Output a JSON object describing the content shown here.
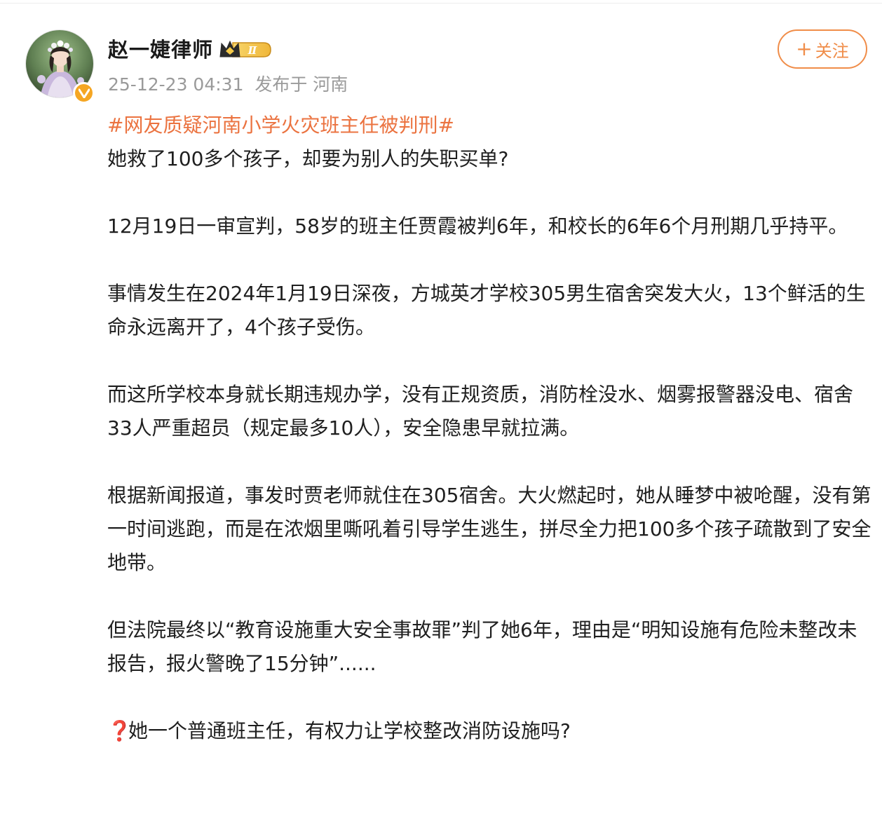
{
  "post": {
    "author": {
      "name": "赵一婕律师",
      "vip_level": "Ⅱ"
    },
    "meta": "25-12-23 04:31  发布于 河南",
    "follow_label": "关注",
    "follow_plus": "+",
    "hashtag": "#网友质疑河南小学火灾班主任被判刑#",
    "paragraphs": [
      "她救了100多个孩子，却要为别人的失职买单?",
      "12月19日一审宣判，58岁的班主任贾霞被判6年，和校长的6年6个月刑期几乎持平。",
      "事情发生在2024年1月19日深夜，方城英才学校305男生宿舍突发大火，13个鲜活的生命永远离开了，4个孩子受伤。",
      "而这所学校本身就长期违规办学，没有正规资质，消防栓没水、烟雾报警器没电、宿舍33人严重超员（规定最多10人），安全隐患早就拉满。",
      "根据新闻报道，事发时贾老师就住在305宿舍。大火燃起时，她从睡梦中被呛醒，没有第一时间逃跑，而是在浓烟里嘶吼着引导学生逃生，拼尽全力把100多个孩子疏散到了安全地带。",
      "但法院最终以“教育设施重大安全事故罪”判了她6年，理由是“明知设施有危险未整改未报告，报火警晚了15分钟”......"
    ],
    "question": {
      "icon": "❓",
      "text": "她一个普通班主任，有权力让学校整改消防设施吗?"
    }
  },
  "colors": {
    "hashtag": "#eb7340",
    "follow": "#f08d49",
    "verified": "#f5a623",
    "meta": "#9a9a9a"
  },
  "icons": {
    "avatar": "avatar-photo",
    "verified": "verified-v-icon",
    "vip": "crown-vip-icon",
    "question": "red-question-icon"
  }
}
